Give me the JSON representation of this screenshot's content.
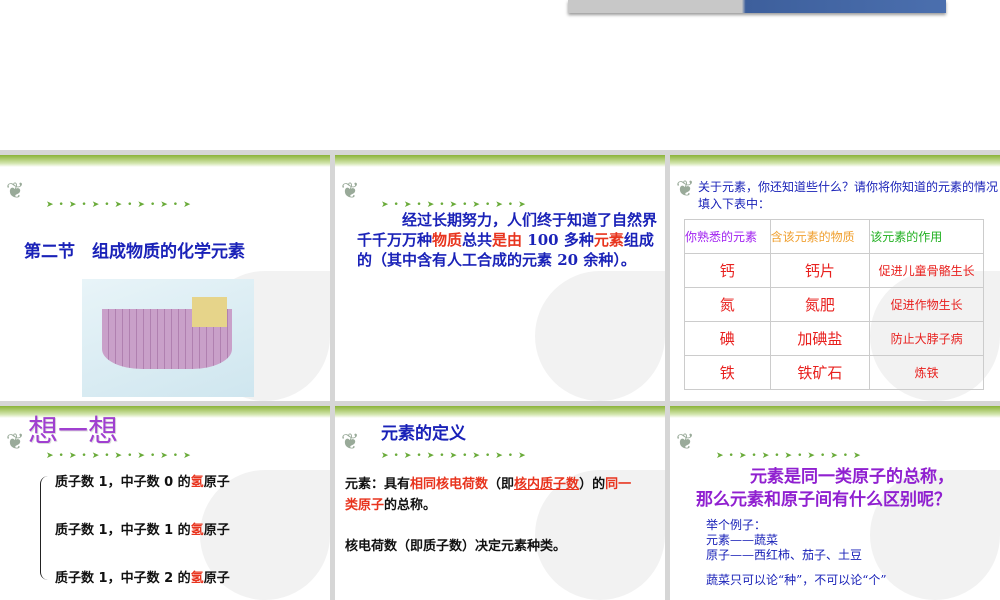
{
  "slide1": {
    "title": "第二节　组成物质的化学元素"
  },
  "slide2": {
    "p1": "经过长期努力，人们终于知道了自然界千千万万种",
    "h1": "物质",
    "p2": "总共",
    "h2": "是由",
    "p3": " 100 多种",
    "h3": "元素",
    "p4": "组成的（其中含有人工合成的元素 20 余种）。"
  },
  "slide3": {
    "intro": "关于元素，你还知道些什么？请你将你知道的元素的情况填入下表中：",
    "headers": [
      "你熟悉的元素",
      "含该元素的物质",
      "该元素的作用"
    ],
    "header_colors": [
      "#a020f0",
      "#f0a030",
      "#20b020"
    ],
    "rows": [
      [
        "钙",
        "钙片",
        "促进儿童骨骼生长"
      ],
      [
        "氮",
        "氮肥",
        "促进作物生长"
      ],
      [
        "碘",
        "加碘盐",
        "防止大脖子病"
      ],
      [
        "铁",
        "铁矿石",
        "炼铁"
      ]
    ]
  },
  "slide4": {
    "title": "想一想",
    "lines": [
      {
        "a": "质子数 1，中子数 0 的",
        "h": "氢",
        "b": "原子"
      },
      {
        "a": "质子数 1，中子数 1 的",
        "h": "氢",
        "b": "原子"
      },
      {
        "a": "质子数 1，中子数 2 的",
        "h": "氢",
        "b": "原子"
      }
    ]
  },
  "slide5": {
    "title": "元素的定义",
    "d1": "元素：具有",
    "d2": "相同核电荷数",
    "d3": "（即",
    "d4": "核内质子数",
    "d5": "）的",
    "d6": "同一类原子",
    "d7": "的总称。",
    "note": "核电荷数（即质子数）决定元素种类。"
  },
  "slide6": {
    "q1": "元素是同一类原子的总称，",
    "q2": "那么元素和原子间有什么区别呢？",
    "e0": "举个例子：",
    "e1": "元素——蔬菜",
    "e2": "原子——西红柿、茄子、土豆",
    "e3": "蔬菜只可以论“种”，不可以论“个”"
  }
}
